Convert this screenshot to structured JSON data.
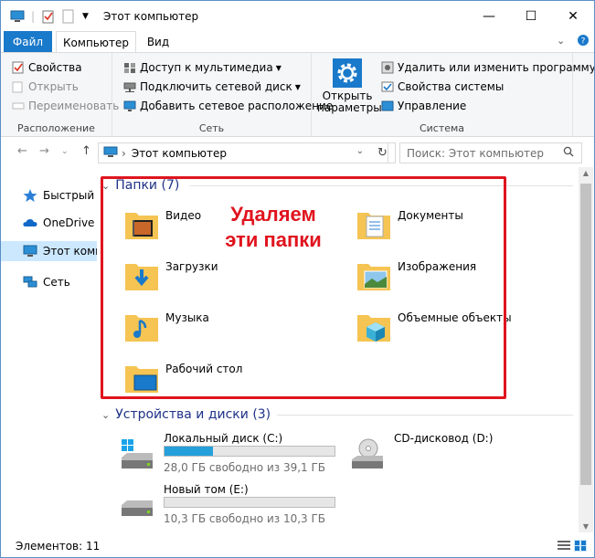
{
  "window": {
    "title": "Этот компьютер",
    "controls": {
      "minimize": "—",
      "maximize": "☐",
      "close": "✕"
    }
  },
  "ribbon": {
    "tabs": {
      "file": "Файл",
      "computer": "Компьютер",
      "view": "Вид"
    },
    "groups": {
      "location": {
        "label": "Расположение",
        "properties": "Свойства",
        "open": "Открыть",
        "rename": "Переименовать"
      },
      "network": {
        "label": "Сеть",
        "media": "Доступ к мультимедиа",
        "map_drive": "Подключить сетевой диск",
        "add_location": "Добавить сетевое расположение"
      },
      "system": {
        "label": "Система",
        "open_settings_1": "Открыть",
        "open_settings_2": "параметры",
        "uninstall": "Удалить или изменить программу",
        "sys_props": "Свойства системы",
        "manage": "Управление"
      }
    }
  },
  "address": {
    "path": "Этот компьютер",
    "search_placeholder": "Поиск: Этот компьютер"
  },
  "nav": {
    "items": [
      {
        "label": "Быстрый д",
        "icon": "star-icon"
      },
      {
        "label": "OneDrive",
        "icon": "cloud-icon"
      },
      {
        "label": "Этот комп",
        "icon": "computer-icon"
      },
      {
        "label": "Сеть",
        "icon": "network-icon"
      }
    ]
  },
  "folders": {
    "header": "Папки (7)",
    "items": [
      {
        "name": "Видео",
        "icon": "video-folder-icon"
      },
      {
        "name": "Документы",
        "icon": "documents-folder-icon"
      },
      {
        "name": "Загрузки",
        "icon": "downloads-folder-icon"
      },
      {
        "name": "Изображения",
        "icon": "pictures-folder-icon"
      },
      {
        "name": "Музыка",
        "icon": "music-folder-icon"
      },
      {
        "name": "Объемные объекты",
        "icon": "3d-objects-folder-icon"
      },
      {
        "name": "Рабочий стол",
        "icon": "desktop-folder-icon"
      }
    ]
  },
  "annotation": {
    "line1": "Удаляем",
    "line2": "эти папки",
    "color": "#e0141e"
  },
  "drives": {
    "header": "Устройства и диски (3)",
    "items": [
      {
        "name": "Локальный диск (C:)",
        "free": "28,0 ГБ свободно из 39,1 ГБ",
        "used_fraction": 0.284
      },
      {
        "name": "CD-дисковод (D:)"
      },
      {
        "name": "Новый том (E:)",
        "free": "10,3 ГБ свободно из 10,3 ГБ",
        "used_fraction": 0.0
      }
    ]
  },
  "status": {
    "count": "Элементов: 11"
  },
  "colors": {
    "accent": "#1979ca",
    "selection": "#cce8ff",
    "folder": "#f5c453",
    "link": "#1e3287"
  }
}
